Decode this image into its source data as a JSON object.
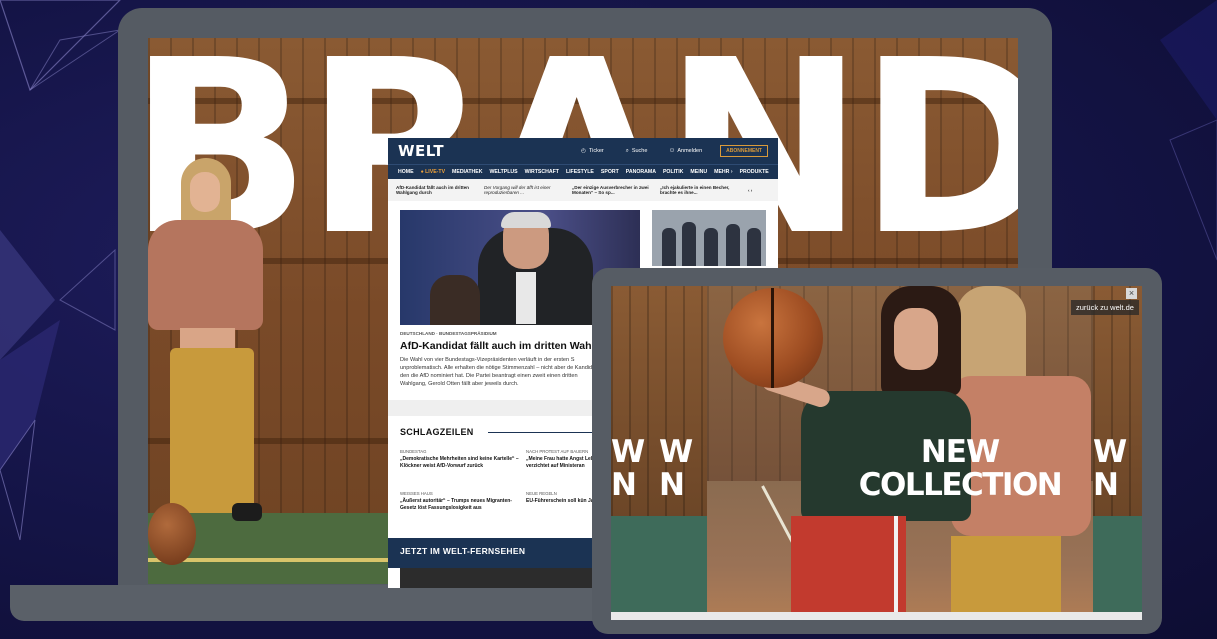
{
  "background": {
    "color": "#161548"
  },
  "laptop": {
    "hero_text": "BRAND",
    "welt": {
      "logo": "WELT",
      "util": {
        "ticker_label": "Ticker",
        "search_label": "Suche",
        "login_label": "Anmelden",
        "abo_button": "ABONNEMENT"
      },
      "nav": [
        "HOME",
        "LIVE-TV",
        "MEDIATHEK",
        "WELTPLUS",
        "WIRTSCHAFT",
        "LIFESTYLE",
        "SPORT",
        "PANORAMA",
        "POLITIK",
        "MEINU",
        "MEHR",
        "PRODUKTE"
      ],
      "ticker": [
        "AfD-Kandidat fällt auch im dritten Wahlgang durch",
        "Der Vorgang will der äfft ist einer reproduzierbaren ...",
        "„Der einzige Ausverbrecher in zwei Monaten“ – So sp...",
        "„Ich ejakulierte in einen Becher, brachte es ihne..."
      ],
      "main_kicker": "DEUTSCHLAND · BUNDESTAGSPRÄSIDIUM",
      "main_headline": "AfD-Kandidat fällt auch im dritten Wahlgang",
      "main_teaser": "Die Wahl von vier Bundestags-Vizepräsidenten verläuft in der ersten S unproblematisch. Alle erhalten die nötige Stimmenzahl – nicht aber de Kandidat, den die AfD nominiert hat. Die Partei beantragt einen zweit einen dritten Wahlgang, Gerold Otten fällt aber jeweils durch.",
      "section_title": "SCHLAGZEILEN",
      "headlines": [
        {
          "kicker": "BUNDESTAG",
          "title": "„Demokratische Mehrheiten sind keine Kartelle“ – Klöckner weist AfD-Vorwurf zurück"
        },
        {
          "kicker": "NACH PROTEST AUF BAUERN",
          "title": "„Meine Frau hatte Angst Leben“ – Söders Wunsch verzichtet auf Ministeran"
        },
        {
          "kicker": "WEISSES HAUS",
          "title": "„Äußerst autoritär“ – Trumps neues Migranten-Gesetz löst Fassungslosigkeit aus"
        },
        {
          "kicker": "NEUE REGELN",
          "title": "EU-Führerschein soll kün Jahre gelten"
        }
      ],
      "tv_section": "JETZT IM WELT-FERNSEHEN"
    }
  },
  "tablet": {
    "headline_line1": "NEW",
    "headline_line2": "COLLECTION",
    "ghost_left_1": "W",
    "ghost_left_2": "N",
    "ghost_right_1": "W",
    "ghost_right_2": "N",
    "back_link": "zurück zu welt.de",
    "close_symbol": "×"
  }
}
